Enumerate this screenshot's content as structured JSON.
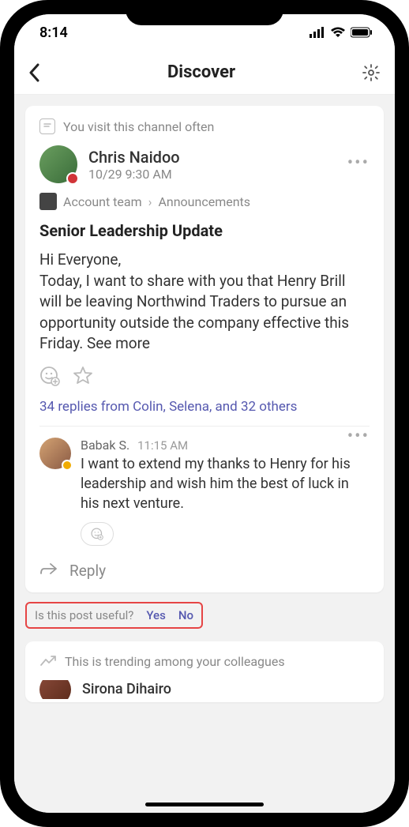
{
  "status": {
    "time": "8:14"
  },
  "nav": {
    "title": "Discover"
  },
  "post": {
    "hint": "You visit this channel often",
    "author": "Chris Naidoo",
    "timestamp": "10/29 9:30 AM",
    "team": "Account team",
    "channel": "Announcements",
    "title": "Senior Leadership Update",
    "body_line1": "Hi Everyone,",
    "body_rest": "Today, I want to share with you that Henry Brill will be leaving Northwind Traders to pursue an opportunity outside the company effective this Friday. ",
    "see_more": "See more",
    "replies_summary": "34 replies from Colin, Selena, and 32 others"
  },
  "reply": {
    "author": "Babak S.",
    "time": "11:15 AM",
    "text": "I want to extend my thanks to Henry for his leadership and wish him the best of luck in his next venture."
  },
  "reply_action": "Reply",
  "feedback": {
    "question": "Is this post useful?",
    "yes": "Yes",
    "no": "No"
  },
  "next_card": {
    "hint": "This is trending among your colleagues",
    "author_partial": "Sirona Dihairo"
  }
}
